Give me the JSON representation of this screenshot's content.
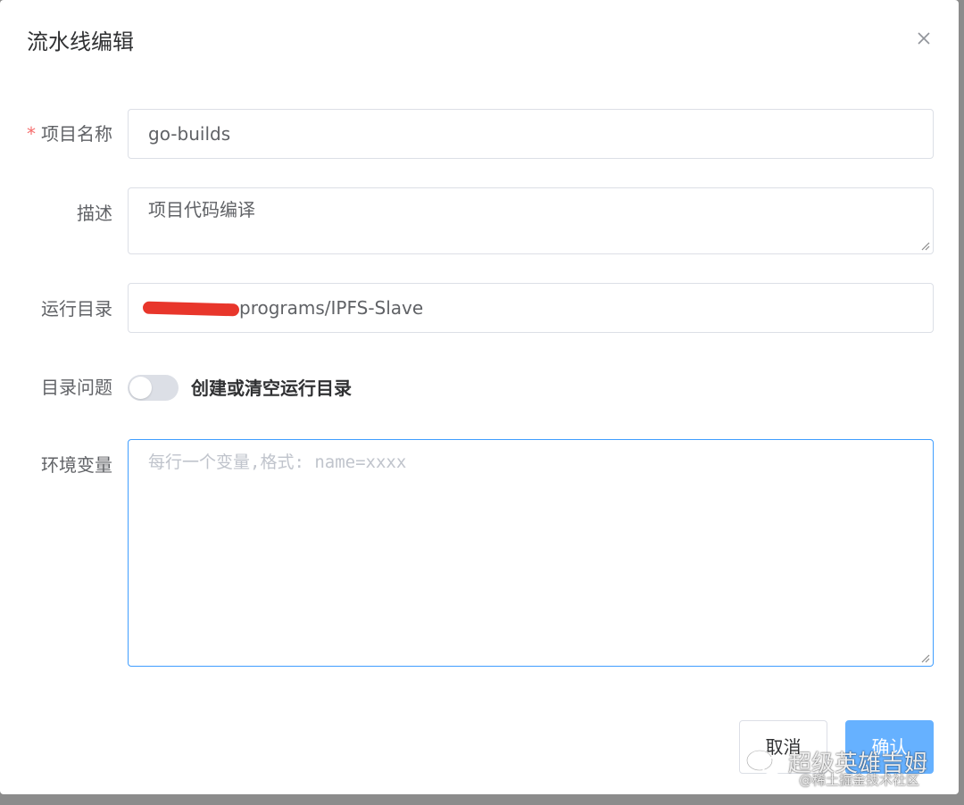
{
  "dialog": {
    "title": "流水线编辑",
    "close_icon": "close-icon"
  },
  "form": {
    "name": {
      "required_mark": "*",
      "label": "项目名称",
      "value": "go-builds"
    },
    "description": {
      "label": "描述",
      "value": "项目代码编译"
    },
    "run_dir": {
      "label": "运行目录",
      "value": "programs/IPFS-Slave"
    },
    "dir_issue": {
      "label": "目录问题",
      "toggle_label": "创建或清空运行目录",
      "toggle_on": false
    },
    "env": {
      "label": "环境变量",
      "placeholder": "每行一个变量,格式: name=xxxx",
      "value": ""
    }
  },
  "footer": {
    "cancel_label": "取消",
    "confirm_label": "确认"
  },
  "watermark": {
    "main": "超级英雄吉姆",
    "sub": "@稀土掘金技术社区"
  },
  "colors": {
    "primary": "#409eff",
    "confirm": "#66b1ff",
    "required": "#f56c6c",
    "redaction": "#e8362b"
  }
}
